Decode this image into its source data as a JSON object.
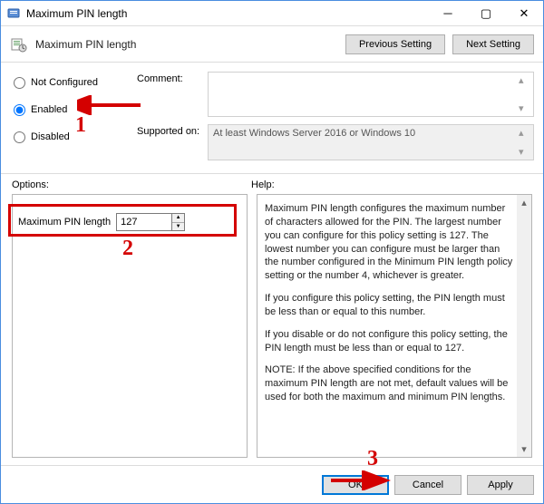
{
  "window_title": "Maximum PIN length",
  "policy_title": "Maximum PIN length",
  "nav": {
    "prev": "Previous Setting",
    "next": "Next Setting"
  },
  "state_options": {
    "not_configured": "Not Configured",
    "enabled": "Enabled",
    "disabled": "Disabled"
  },
  "labels": {
    "comment": "Comment:",
    "supported_on": "Supported on:",
    "options": "Options:",
    "help": "Help:"
  },
  "supported_on_text": "At least Windows Server 2016 or Windows 10",
  "option_field": {
    "label": "Maximum PIN length",
    "value": "127"
  },
  "help_paragraphs": [
    "Maximum PIN length configures the maximum number of characters allowed for the PIN.  The largest number you can configure for this policy setting is 127. The lowest number you can configure must be larger than the number configured in the Minimum PIN length policy setting or the number 4, whichever is greater.",
    "If you configure this policy setting, the PIN length must be less than or equal to this number.",
    "If you disable or do not configure this policy setting, the PIN length must be less than or equal to 127.",
    "NOTE: If the above specified conditions for the maximum PIN length are not met, default values will be used for both the maximum and minimum PIN lengths."
  ],
  "buttons": {
    "ok": "OK",
    "cancel": "Cancel",
    "apply": "Apply"
  },
  "annotations": {
    "n1": "1",
    "n2": "2",
    "n3": "3"
  }
}
